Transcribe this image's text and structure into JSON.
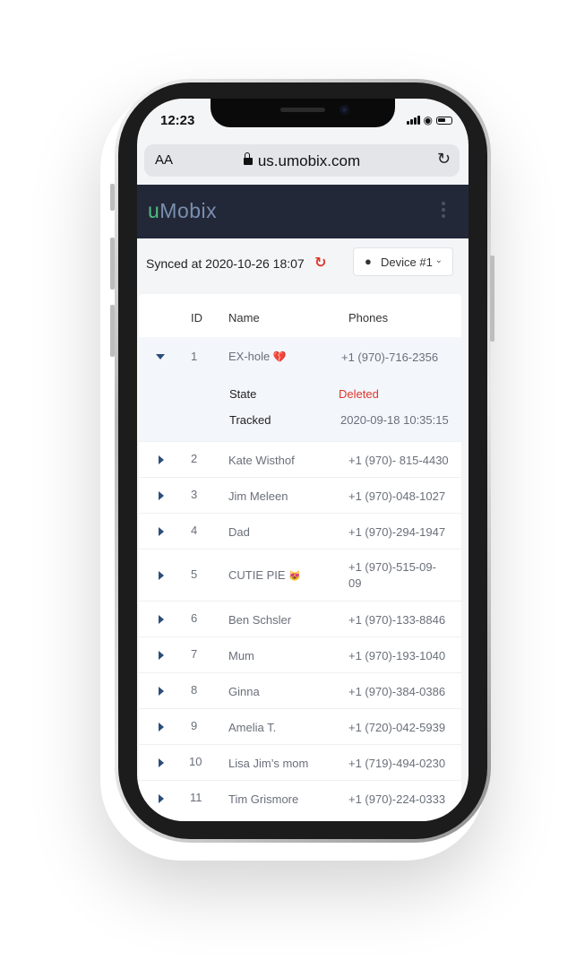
{
  "status_bar": {
    "time": "12:23"
  },
  "browser": {
    "text_size_label": "AA",
    "url": "us.umobix.com",
    "reload_icon": "reload-icon",
    "lock_icon": "lock-icon"
  },
  "app": {
    "logo_u": "u",
    "logo_rest": "Mobix",
    "menu_icon": "kebab-menu-icon"
  },
  "sync": {
    "text": "Synced at 2020-10-26 18:07",
    "icon": "sync-icon",
    "icon_color": "#e0362c"
  },
  "device_select": {
    "label": "Device #1",
    "icon": "apple-icon"
  },
  "table": {
    "headers": {
      "id": "ID",
      "name": "Name",
      "phones": "Phones"
    },
    "rows": [
      {
        "id": "1",
        "name": "EX-hole",
        "emoji": "💔",
        "phone": "+1 (970)-716-2356",
        "expanded": true
      },
      {
        "id": "2",
        "name": "Kate Wisthof",
        "phone": "+1 (970)- 815-4430"
      },
      {
        "id": "3",
        "name": "Jim Meleen",
        "phone": "+1 (970)-048-1027"
      },
      {
        "id": "4",
        "name": "Dad",
        "phone": "+1 (970)-294-1947"
      },
      {
        "id": "5",
        "name": "CUTIE PIE",
        "emoji": "😻",
        "phone": "+1 (970)-515-09-09"
      },
      {
        "id": "6",
        "name": "Ben Schsler",
        "phone": "+1 (970)-133-8846"
      },
      {
        "id": "7",
        "name": "Mum",
        "phone": "+1 (970)-193-1040"
      },
      {
        "id": "8",
        "name": "Ginna",
        "phone": "+1 (970)-384-0386"
      },
      {
        "id": "9",
        "name": "Amelia T.",
        "phone": "+1 (720)-042-5939"
      },
      {
        "id": "10",
        "name": "Lisa Jim’s mom",
        "phone": "+1 (719)-494-0230"
      },
      {
        "id": "11",
        "name": "Tim Grismore",
        "phone": "+1 (970)-224-0333"
      }
    ],
    "detail": {
      "state_label": "State",
      "state_value": "Deleted",
      "state_color": "#e0362c",
      "tracked_label": "Tracked",
      "tracked_value": "2020-09-18 10:35:15"
    }
  },
  "colors": {
    "app_bar": "#232838",
    "logo_accent": "#4fbf7f",
    "logo_text": "#7a8fb0",
    "expand_arrow": "#2c4d7a"
  }
}
